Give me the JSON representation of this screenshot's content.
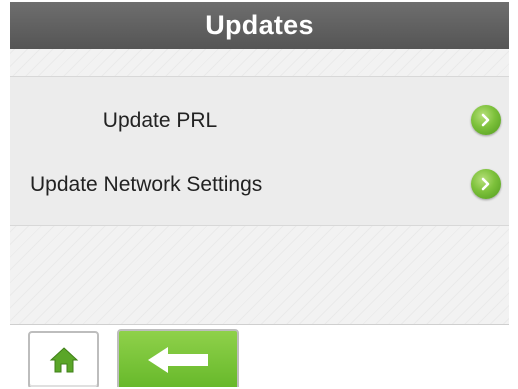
{
  "header": {
    "title": "Updates"
  },
  "menu": {
    "items": [
      {
        "label": "Update PRL",
        "icon": "chevron-right-icon"
      },
      {
        "label": "Update Network Settings",
        "icon": "chevron-right-icon"
      }
    ]
  },
  "footer": {
    "home_icon": "home-icon",
    "back_icon": "arrow-left-icon"
  },
  "colors": {
    "title_bar": "#5f5f5f",
    "accent_green": "#7dc13b",
    "back_button_green": "#75c13a"
  }
}
